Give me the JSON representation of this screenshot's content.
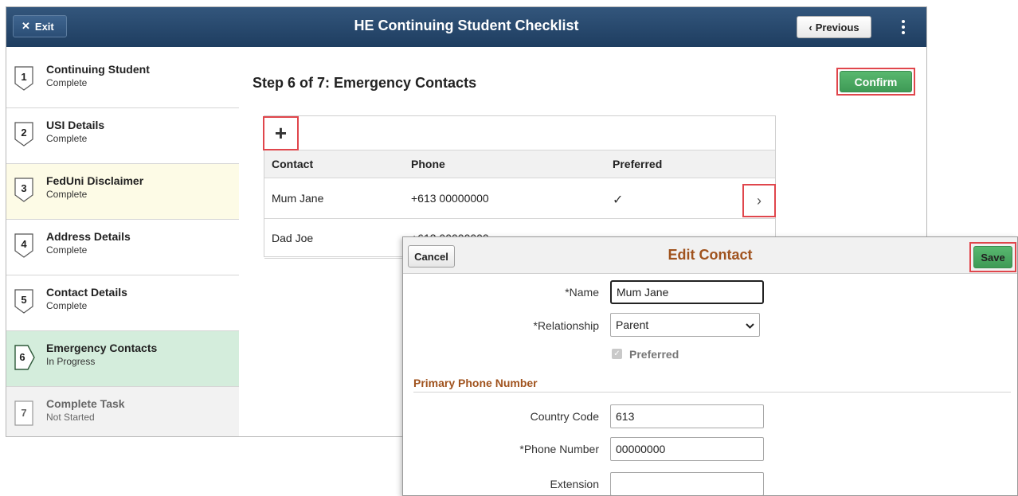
{
  "banner": {
    "title": "HE Continuing Student Checklist",
    "exit_label": "Exit",
    "previous_label": "Previous"
  },
  "steps": [
    {
      "num": "1",
      "title": "Continuing Student",
      "status": "Complete"
    },
    {
      "num": "2",
      "title": "USI Details",
      "status": "Complete"
    },
    {
      "num": "3",
      "title": "FedUni Disclaimer",
      "status": "Complete"
    },
    {
      "num": "4",
      "title": "Address Details",
      "status": "Complete"
    },
    {
      "num": "5",
      "title": "Contact Details",
      "status": "Complete"
    },
    {
      "num": "6",
      "title": "Emergency Contacts",
      "status": "In Progress"
    },
    {
      "num": "7",
      "title": "Complete Task",
      "status": "Not Started"
    }
  ],
  "content": {
    "heading": "Step 6 of 7: Emergency Contacts",
    "confirm_label": "Confirm",
    "columns": {
      "contact": "Contact",
      "phone": "Phone",
      "preferred": "Preferred"
    },
    "rows": [
      {
        "contact": "Mum Jane",
        "phone": "+613 00000000",
        "preferred": "✓"
      },
      {
        "contact": "Dad Joe",
        "phone": "+613 00000000",
        "preferred": ""
      }
    ]
  },
  "modal": {
    "title": "Edit Contact",
    "cancel_label": "Cancel",
    "save_label": "Save",
    "name_label": "*Name",
    "name_value": "Mum Jane",
    "relationship_label": "*Relationship",
    "relationship_value": "Parent",
    "preferred_label": "Preferred",
    "phone_section": "Primary Phone Number",
    "country_code_label": "Country Code",
    "country_code_value": "613",
    "phone_number_label": "*Phone Number",
    "phone_number_value": "00000000",
    "extension_label": "Extension",
    "extension_value": ""
  },
  "colors": {
    "banner": "#1e3d60",
    "accent_green": "#3e9a56",
    "highlight_red": "#e0464c",
    "title_brown": "#a0531e",
    "current_step": "#d4eddc"
  }
}
